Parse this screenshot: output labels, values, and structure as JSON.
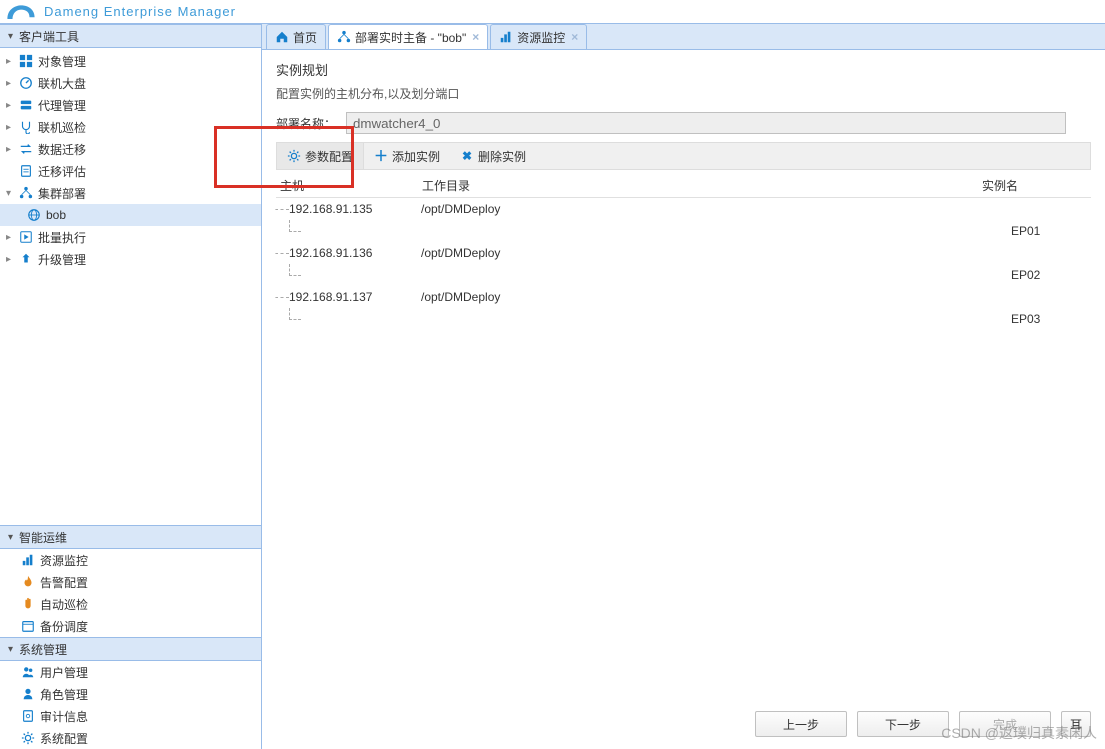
{
  "brand": "Dameng  Enterprise  Manager",
  "sidebar": {
    "panels": [
      {
        "title": "客户端工具",
        "type": "tree",
        "items": [
          {
            "label": "对象管理",
            "icon": "grid"
          },
          {
            "label": "联机大盘",
            "icon": "gauge"
          },
          {
            "label": "代理管理",
            "icon": "server"
          },
          {
            "label": "联机巡检",
            "icon": "stetho"
          },
          {
            "label": "数据迁移",
            "icon": "exchange"
          },
          {
            "label": "迁移评估",
            "icon": "clipboard"
          },
          {
            "label": "集群部署",
            "icon": "cluster",
            "expanded": true,
            "children": [
              {
                "label": "bob",
                "icon": "globe",
                "selected": true
              }
            ]
          },
          {
            "label": "批量执行",
            "icon": "play"
          },
          {
            "label": "升级管理",
            "icon": "upgrade"
          }
        ]
      },
      {
        "title": "智能运维",
        "type": "list",
        "items": [
          {
            "label": "资源监控",
            "icon": "bars"
          },
          {
            "label": "告警配置",
            "icon": "flame"
          },
          {
            "label": "自动巡检",
            "icon": "hand"
          },
          {
            "label": "备份调度",
            "icon": "calendar"
          }
        ]
      },
      {
        "title": "系统管理",
        "type": "list",
        "items": [
          {
            "label": "用户管理",
            "icon": "users"
          },
          {
            "label": "角色管理",
            "icon": "role"
          },
          {
            "label": "审计信息",
            "icon": "audit"
          },
          {
            "label": "系统配置",
            "icon": "gear"
          }
        ]
      }
    ]
  },
  "tabs": [
    {
      "label": "首页",
      "icon": "home",
      "closable": false,
      "active": false
    },
    {
      "label": "部署实时主备 - \"bob\"",
      "icon": "cluster",
      "closable": true,
      "active": true
    },
    {
      "label": "资源监控",
      "icon": "bars",
      "closable": true,
      "active": false
    }
  ],
  "page": {
    "title": "实例规划",
    "subtitle": "配置实例的主机分布,以及划分端口",
    "deploy_label": "部署名称：",
    "deploy_value": "dmwatcher4_0",
    "toolbar": {
      "param_config": "参数配置",
      "add_instance": "添加实例",
      "del_instance": "删除实例"
    },
    "columns": {
      "host": "主机",
      "dir": "工作目录",
      "name": "实例名"
    },
    "rows": [
      {
        "host": "192.168.91.135",
        "dir": "/opt/DMDeploy",
        "name": "EP01"
      },
      {
        "host": "192.168.91.136",
        "dir": "/opt/DMDeploy",
        "name": "EP02"
      },
      {
        "host": "192.168.91.137",
        "dir": "/opt/DMDeploy",
        "name": "EP03"
      }
    ],
    "buttons": {
      "prev": "上一步",
      "next": "下一步",
      "finish": "完成",
      "retry": "耳"
    }
  },
  "watermark": "CSDN @返璞归真素闲人"
}
